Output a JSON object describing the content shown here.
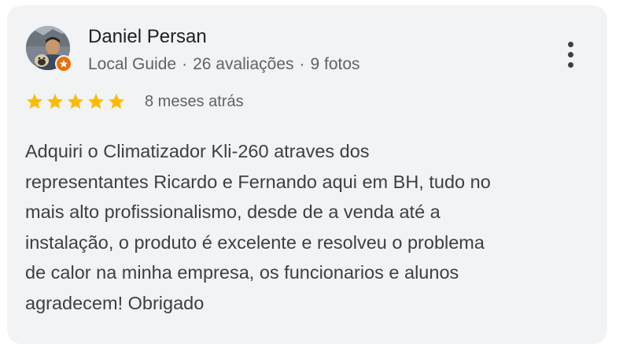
{
  "reviewer": {
    "name": "Daniel Persan",
    "badge": "Local Guide",
    "reviews": "26 avaliações",
    "photos": "9 fotos",
    "separator": "·"
  },
  "rating": {
    "stars": 5,
    "max": 5,
    "color": "#fbbc04",
    "date": "8 meses atrás"
  },
  "review": {
    "lines": [
      "Adquiri o Climatizador Kli-260 atraves dos",
      "representantes Ricardo e Fernando aqui em BH, tudo no",
      "mais alto profissionalismo, desde de a venda até a",
      "instalação, o produto é excelente e resolveu o problema",
      "de calor na minha empresa, os funcionarios e alunos",
      "agradecem! Obrigado"
    ]
  },
  "icons": {
    "menu": "more-vert-icon",
    "badge": "local-guide-star-icon"
  },
  "colors": {
    "card": "#f1f3f4",
    "guide_badge": "#e8710a"
  }
}
